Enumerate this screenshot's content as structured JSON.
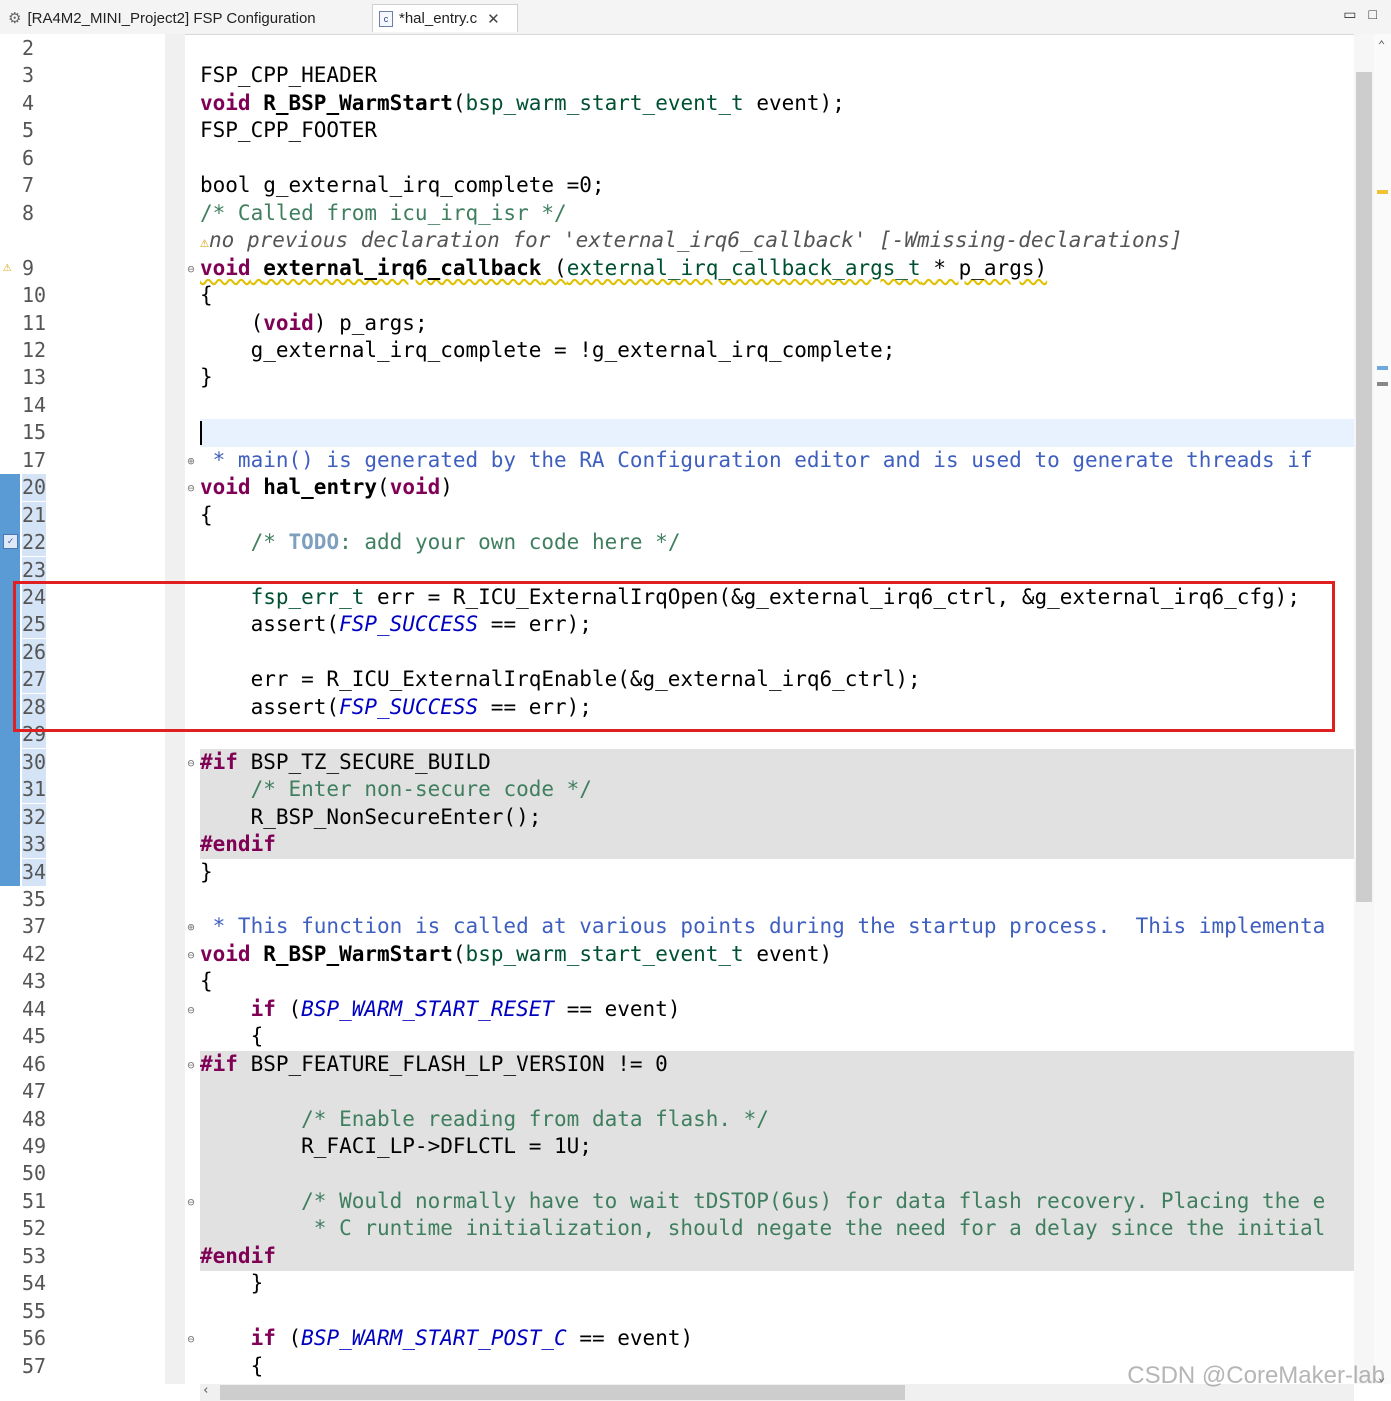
{
  "window": {
    "tabs": [
      {
        "label": "[RA4M2_MINI_Project2] FSP Configuration",
        "icon": "gear-icon",
        "active": false
      },
      {
        "label": "*hal_entry.c",
        "icon": "c-file-icon",
        "active": true
      }
    ],
    "controls": {
      "minimize": "▭",
      "maximize": "□"
    }
  },
  "editor": {
    "lines": [
      {
        "n": "2",
        "html": ""
      },
      {
        "n": "3",
        "html": "FSP_CPP_HEADER"
      },
      {
        "n": "4",
        "html": "<span class=\"kw\">void</span> <span class=\"fn\">R_BSP_WarmStart</span>(<span class=\"ty\">bsp_warm_start_event_t</span> event);"
      },
      {
        "n": "5",
        "html": "FSP_CPP_FOOTER"
      },
      {
        "n": "6",
        "html": ""
      },
      {
        "n": "7",
        "html": "bool g_external_irq_complete =0;"
      },
      {
        "n": "8",
        "html": "<span class=\"cm\">/* Called from icu_irq_isr */</span>"
      },
      {
        "n": "",
        "html": "<span class=\"warnmsg\">no previous declaration for 'external_irq6_callback' [-Wmissing-declarations]</span>",
        "warnline": true
      },
      {
        "n": "9",
        "html": "<span class=\"kw\">void</span> <span class=\"fn\">external_irq6_callback</span> (<span class=\"ty\">external_irq_callback_args_t</span> * p_args)",
        "warn": true,
        "fold": "minus"
      },
      {
        "n": "10",
        "html": "{"
      },
      {
        "n": "11",
        "html": "    (<span class=\"kw\">void</span>) p_args;"
      },
      {
        "n": "12",
        "html": "    g_external_irq_complete = !g_external_irq_complete;"
      },
      {
        "n": "13",
        "html": "}"
      },
      {
        "n": "14",
        "html": ""
      },
      {
        "n": "15",
        "html": "",
        "cursor": true
      },
      {
        "n": "17",
        "html": "<span class=\"jd\"> * main() is generated by the RA Configuration editor and is used to generate threads if</span>",
        "fold": "plus"
      },
      {
        "n": "20",
        "html": "<span class=\"kw\">void</span> <span class=\"fn\">hal_entry</span>(<span class=\"kw\">void</span>)",
        "fold": "minus"
      },
      {
        "n": "21",
        "html": "{"
      },
      {
        "n": "22",
        "html": "    <span class=\"cm\">/* <span style=\"color:#7f9fbf;font-weight:bold\">TODO</span>: add your own code here */</span>",
        "task": true
      },
      {
        "n": "23",
        "html": ""
      },
      {
        "n": "24",
        "html": "    <span class=\"ty\">fsp_err_t</span> err = R_ICU_ExternalIrqOpen(&amp;g_external_irq6_ctrl, &amp;g_external_irq6_cfg);"
      },
      {
        "n": "25",
        "html": "    assert(<span class=\"mc\">FSP_SUCCESS</span> == err);"
      },
      {
        "n": "26",
        "html": ""
      },
      {
        "n": "27",
        "html": "    err = R_ICU_ExternalIrqEnable(&amp;g_external_irq6_ctrl);"
      },
      {
        "n": "28",
        "html": "    assert(<span class=\"mc\">FSP_SUCCESS</span> == err);"
      },
      {
        "n": "29",
        "html": ""
      },
      {
        "n": "30",
        "html": "<span class=\"pp\">#if</span> BSP_TZ_SECURE_BUILD",
        "fold": "minus",
        "gray": true
      },
      {
        "n": "31",
        "html": "    <span class=\"cm\">/* Enter non-secure code */</span>",
        "gray": true
      },
      {
        "n": "32",
        "html": "    R_BSP_NonSecureEnter();",
        "gray": true
      },
      {
        "n": "33",
        "html": "<span class=\"pp\">#endif</span>",
        "gray": true
      },
      {
        "n": "34",
        "html": "}"
      },
      {
        "n": "35",
        "html": ""
      },
      {
        "n": "37",
        "html": "<span class=\"jd\"> * This function is called at various points during the startup process.  This implementa</span>",
        "fold": "plus"
      },
      {
        "n": "42",
        "html": "<span class=\"kw\">void</span> <span class=\"fn\">R_BSP_WarmStart</span>(<span class=\"ty\">bsp_warm_start_event_t</span> event)",
        "fold": "minus"
      },
      {
        "n": "43",
        "html": "{"
      },
      {
        "n": "44",
        "html": "    <span class=\"kw\">if</span> (<span class=\"mc\">BSP_WARM_START_RESET</span> == event)",
        "fold": "minus"
      },
      {
        "n": "45",
        "html": "    {"
      },
      {
        "n": "46",
        "html": "<span class=\"pp\">#if</span> BSP_FEATURE_FLASH_LP_VERSION != 0",
        "fold": "minus",
        "gray": true
      },
      {
        "n": "47",
        "html": "",
        "gray": true
      },
      {
        "n": "48",
        "html": "        <span class=\"cm\">/* Enable reading from data flash. */</span>",
        "gray": true
      },
      {
        "n": "49",
        "html": "        R_FACI_LP->DFLCTL = 1U;",
        "gray": true
      },
      {
        "n": "50",
        "html": "",
        "gray": true
      },
      {
        "n": "51",
        "html": "        <span class=\"cm\">/* Would normally have to wait tDSTOP(6us) for data flash recovery. Placing the e</span>",
        "fold": "minus",
        "gray": true
      },
      {
        "n": "52",
        "html": "<span class=\"cm\">         * C runtime initialization, should negate the need for a delay since the initial</span>",
        "gray": true
      },
      {
        "n": "53",
        "html": "<span class=\"pp\">#endif</span>",
        "gray": true
      },
      {
        "n": "54",
        "html": "    }"
      },
      {
        "n": "55",
        "html": ""
      },
      {
        "n": "56",
        "html": "    <span class=\"kw\">if</span> (<span class=\"mc\">BSP_WARM_START_POST_C</span> == event)",
        "fold": "minus"
      },
      {
        "n": "57",
        "html": "    {"
      }
    ]
  },
  "watermark": "CSDN @CoreMaker-lab"
}
